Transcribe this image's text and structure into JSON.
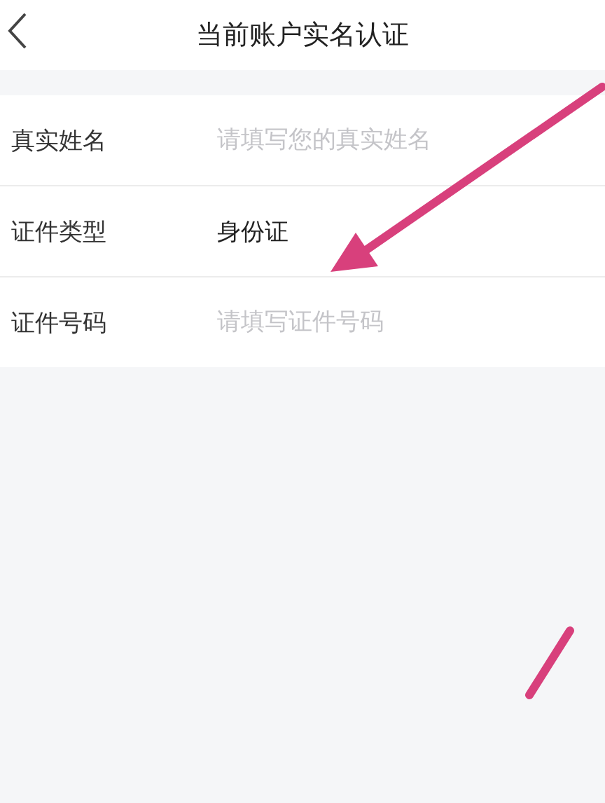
{
  "header": {
    "title": "当前账户实名认证"
  },
  "form": [
    {
      "kind": "input",
      "label": "真实姓名",
      "placeholder": "请填写您的真实姓名"
    },
    {
      "kind": "value",
      "label": "证件类型",
      "value": "身份证"
    },
    {
      "kind": "input",
      "label": "证件号码",
      "placeholder": "请填写证件号码"
    }
  ]
}
